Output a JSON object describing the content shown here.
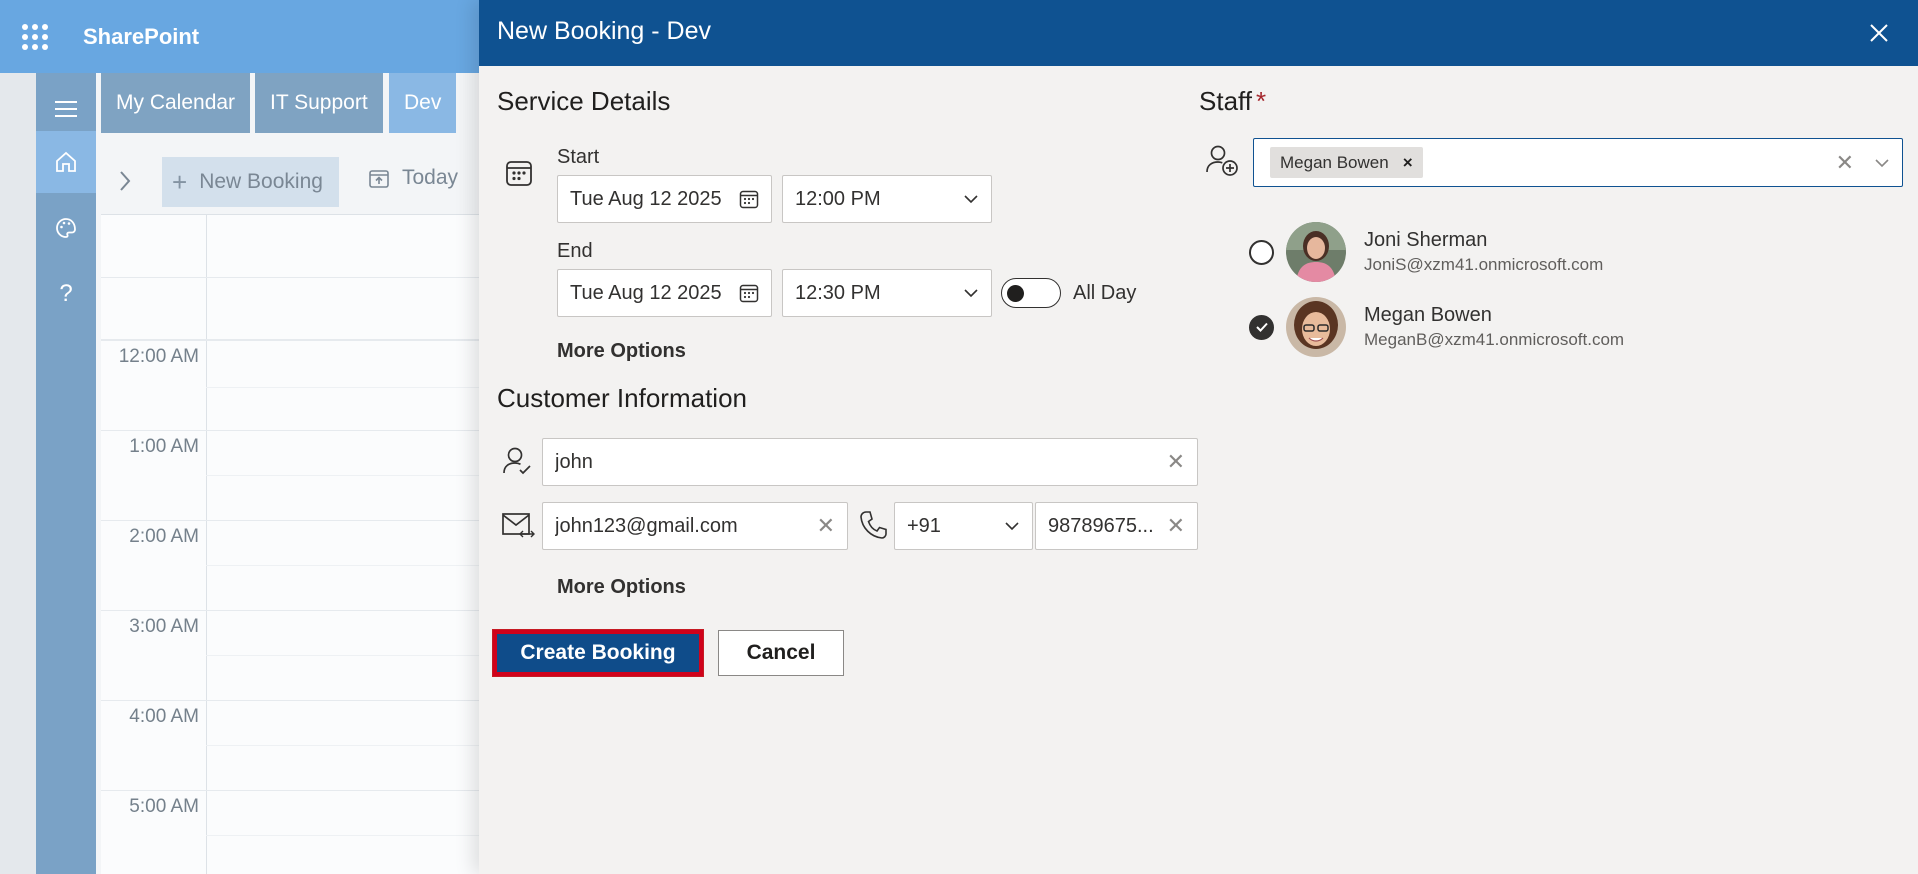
{
  "app": {
    "title": "SharePoint"
  },
  "calendar": {
    "tabs": [
      {
        "label": "My Calendar"
      },
      {
        "label": "IT Support"
      },
      {
        "label": "Dev"
      }
    ],
    "toolbar": {
      "new_booking": "New Booking",
      "today": "Today"
    },
    "times": [
      "12:00 AM",
      "1:00 AM",
      "2:00 AM",
      "3:00 AM",
      "4:00 AM",
      "5:00 AM"
    ]
  },
  "dialog": {
    "title": "New Booking - Dev",
    "service_details": {
      "title": "Service Details",
      "start_label": "Start",
      "start_date": "Tue Aug 12 2025",
      "start_time": "12:00 PM",
      "end_label": "End",
      "end_date": "Tue Aug 12 2025",
      "end_time": "12:30 PM",
      "all_day_label": "All Day",
      "all_day": false,
      "more_options": "More Options"
    },
    "customer": {
      "title": "Customer Information",
      "name": "john",
      "email": "john123@gmail.com",
      "country_code": "+91",
      "phone": "98789675...",
      "more_options": "More Options"
    },
    "staff": {
      "title": "Staff",
      "required_mark": "*",
      "selected_chip": "Megan Bowen",
      "members": [
        {
          "name": "Joni Sherman",
          "email": "JoniS@xzm41.onmicrosoft.com",
          "selected": false
        },
        {
          "name": "Megan Bowen",
          "email": "MeganB@xzm41.onmicrosoft.com",
          "selected": true
        }
      ]
    },
    "actions": {
      "create": "Create Booking",
      "cancel": "Cancel"
    }
  },
  "colors": {
    "header": "#0f5291",
    "sharepoint_bar": "#68a7e1",
    "primary_button": "#0f4c8a",
    "highlight_border": "#d0021b"
  }
}
